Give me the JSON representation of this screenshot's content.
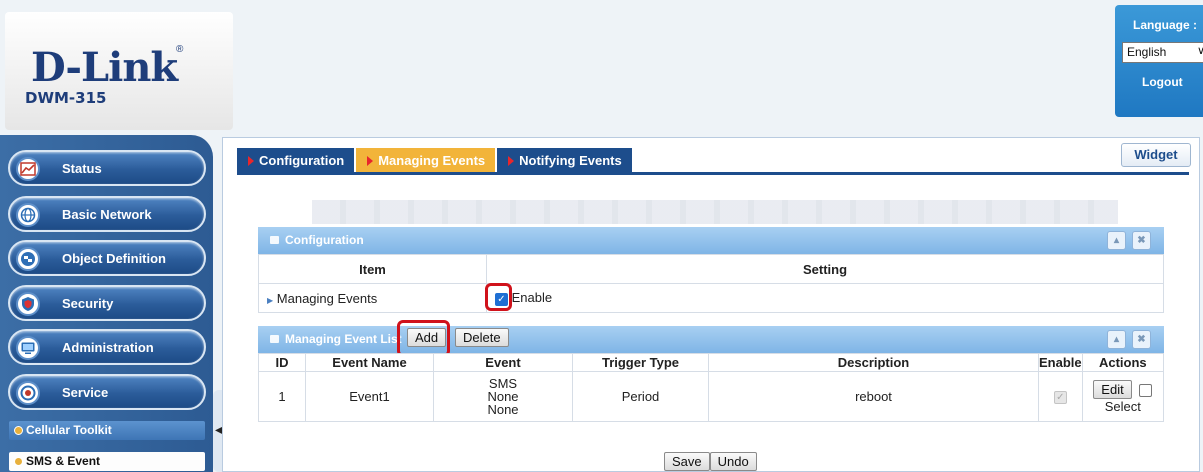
{
  "brand": {
    "logo": "D-Link",
    "registered": "®",
    "model": "DWM-315"
  },
  "language_panel": {
    "label": "Language :",
    "selected": "English",
    "logout": "Logout"
  },
  "sidebar": {
    "items": [
      {
        "label": "Status",
        "icon": "chart-icon"
      },
      {
        "label": "Basic Network",
        "icon": "globe-icon"
      },
      {
        "label": "Object Definition",
        "icon": "object-icon"
      },
      {
        "label": "Security",
        "icon": "shield-icon"
      },
      {
        "label": "Administration",
        "icon": "admin-icon"
      },
      {
        "label": "Service",
        "icon": "service-icon"
      }
    ],
    "sub_items": [
      {
        "label": "Cellular Toolkit"
      },
      {
        "label": "SMS & Event"
      }
    ]
  },
  "tabs": [
    {
      "label": "Configuration",
      "active": false
    },
    {
      "label": "Managing Events",
      "active": true
    },
    {
      "label": "Notifying Events",
      "active": false
    }
  ],
  "widget_label": "Widget",
  "config_panel": {
    "title": "Configuration",
    "headers": {
      "item": "Item",
      "setting": "Setting"
    },
    "row": {
      "item": "Managing Events",
      "setting": "Enable",
      "checked": true
    }
  },
  "event_list_panel": {
    "title": "Managing Event List",
    "add_label": "Add",
    "delete_label": "Delete",
    "headers": [
      "ID",
      "Event Name",
      "Event",
      "Trigger Type",
      "Description",
      "Enable",
      "Actions"
    ],
    "rows": [
      {
        "id": "1",
        "name": "Event1",
        "events": [
          "SMS",
          "None",
          "None"
        ],
        "trigger": "Period",
        "description": "reboot",
        "enabled": true,
        "edit_label": "Edit",
        "select_label": "Select"
      }
    ]
  },
  "footer": {
    "save_label": "Save",
    "undo_label": "Undo"
  },
  "colors": {
    "accent_tab": "#f2b43a",
    "tab_bg": "#1d4d8c",
    "highlight": "#d0121b",
    "panel_head": "#8fc2ec"
  }
}
